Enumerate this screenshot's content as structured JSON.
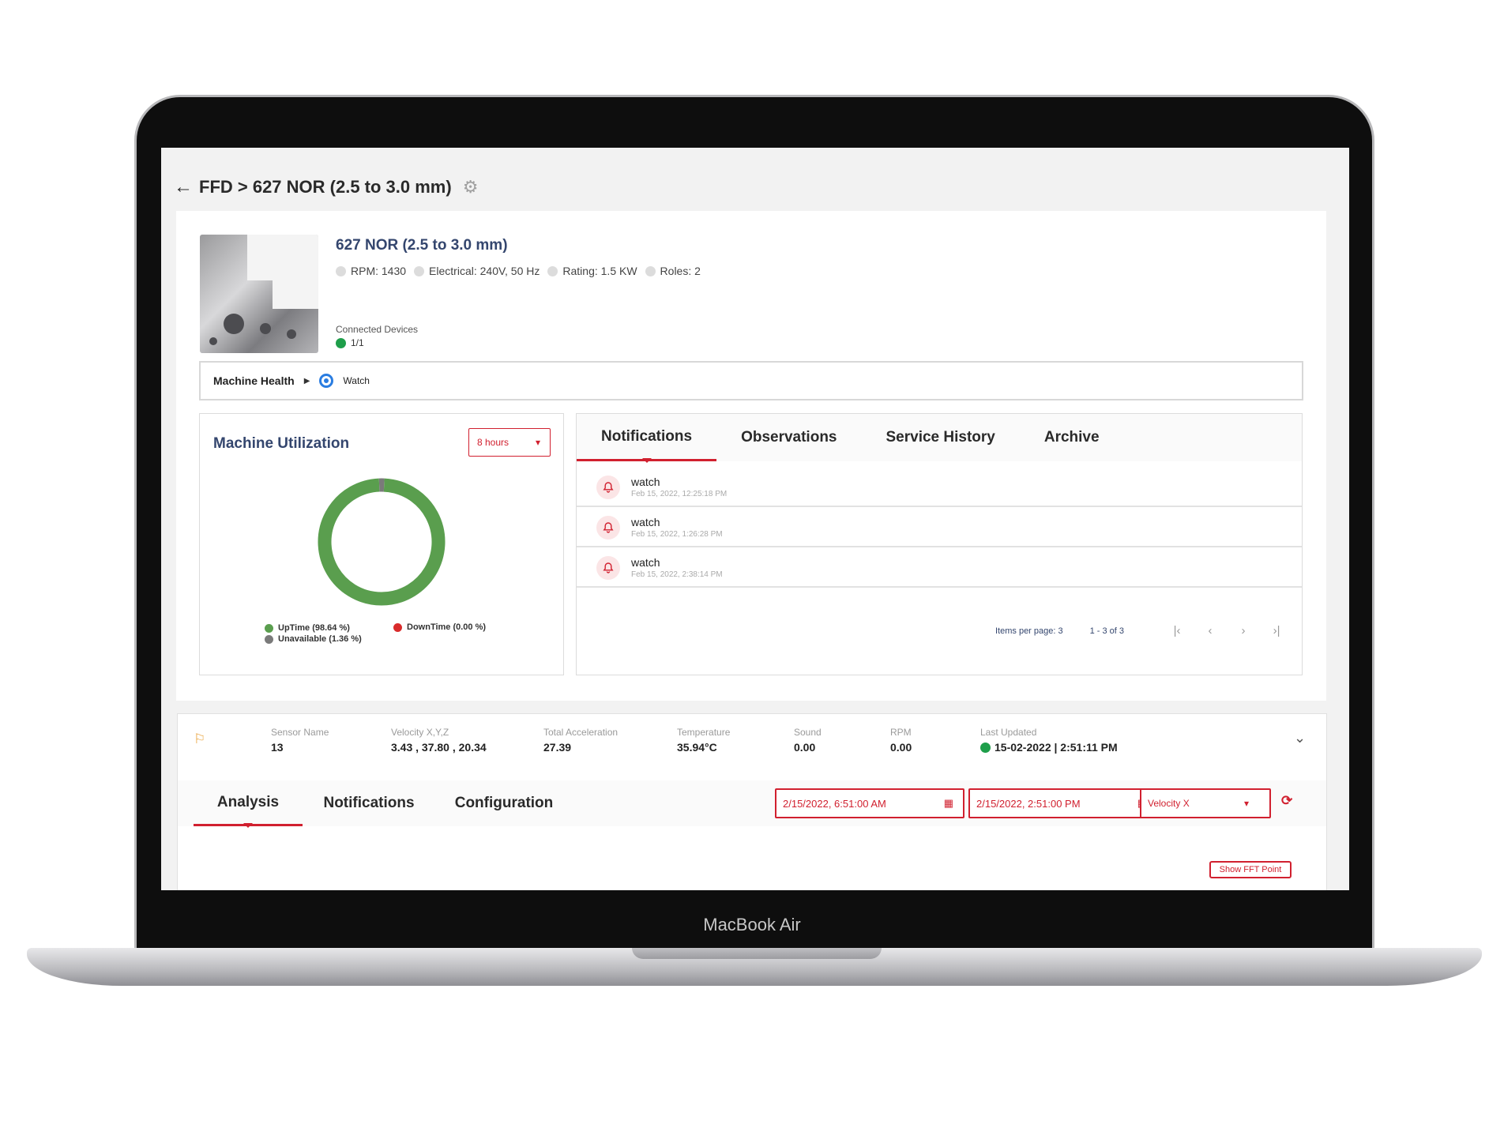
{
  "device": {
    "brand_label": "MacBook Air"
  },
  "header": {
    "breadcrumb": "FFD > 627 NOR (2.5 to 3.0 mm)"
  },
  "machine": {
    "name": "627 NOR (2.5 to 3.0 mm)",
    "specs": [
      "RPM: 1430",
      "Electrical: 240V, 50 Hz",
      "Rating: 1.5 KW",
      "Roles: 2"
    ],
    "connected_label": "Connected Devices",
    "connected_value": "1/1"
  },
  "health": {
    "label": "Machine Health",
    "status": "Watch"
  },
  "utilization": {
    "title": "Machine Utilization",
    "range": "8 hours",
    "legend": {
      "uptime": "UpTime (98.64 %)",
      "unavailable": "Unavailable (1.36 %)",
      "downtime": "DownTime (0.00 %)"
    }
  },
  "chart_data": {
    "type": "pie",
    "categories": [
      "UpTime",
      "Unavailable",
      "DownTime"
    ],
    "values": [
      98.64,
      1.36,
      0.0
    ],
    "colors": [
      "#5a9e4e",
      "#7a7a7a",
      "#d92b2b"
    ]
  },
  "notifications_panel": {
    "tabs": [
      "Notifications",
      "Observations",
      "Service History",
      "Archive"
    ],
    "items": [
      {
        "title": "watch",
        "time": "Feb 15, 2022, 12:25:18 PM"
      },
      {
        "title": "watch",
        "time": "Feb 15, 2022, 1:26:28 PM"
      },
      {
        "title": "watch",
        "time": "Feb 15, 2022, 2:38:14 PM"
      }
    ],
    "pager": {
      "items_per_page": "Items per page: 3",
      "range": "1 - 3 of 3"
    }
  },
  "sensor": {
    "metrics": [
      {
        "label": "Sensor Name",
        "value": "13"
      },
      {
        "label": "Velocity X,Y,Z",
        "value": "3.43 , 37.80 , 20.34"
      },
      {
        "label": "Total Acceleration",
        "value": "27.39"
      },
      {
        "label": "Temperature",
        "value": "35.94°C"
      },
      {
        "label": "Sound",
        "value": "0.00"
      },
      {
        "label": "RPM",
        "value": "0.00"
      },
      {
        "label": "Last Updated",
        "value": "15-02-2022 | 2:51:11 PM"
      }
    ],
    "tabs": [
      "Analysis",
      "Notifications",
      "Configuration"
    ],
    "start_date": "2/15/2022, 6:51:00 AM",
    "end_date": "2/15/2022, 2:51:00 PM",
    "axis_select": "Velocity X",
    "fft_button": "Show FFT Point"
  }
}
